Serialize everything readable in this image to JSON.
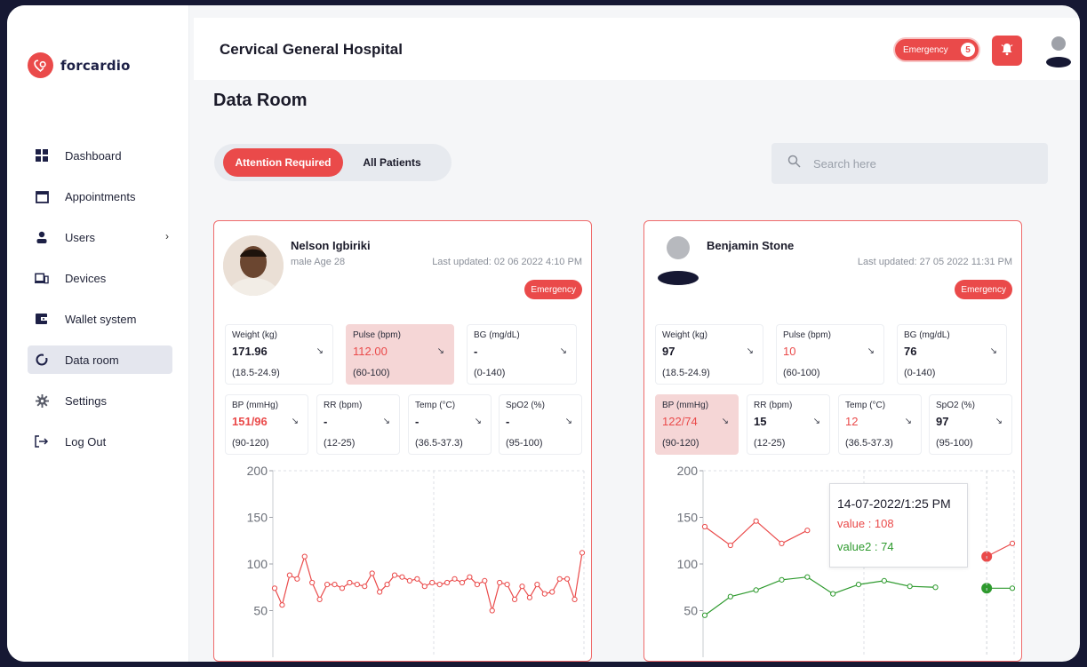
{
  "brand": {
    "name": "forcardio",
    "accent": "#ea4a4a"
  },
  "sidebar": {
    "items": [
      {
        "label": "Dashboard",
        "icon": "dashboard-grid-icon"
      },
      {
        "label": "Appointments",
        "icon": "calendar-icon"
      },
      {
        "label": "Users",
        "icon": "user-icon"
      },
      {
        "label": "Devices",
        "icon": "devices-icon"
      },
      {
        "label": "Wallet system",
        "icon": "wallet-icon"
      },
      {
        "label": "Data room",
        "icon": "data-room-icon",
        "active": true
      },
      {
        "label": "Settings",
        "icon": "gear-icon"
      },
      {
        "label": "Log Out",
        "icon": "logout-icon"
      }
    ]
  },
  "header": {
    "hospital": "Cervical General Hospital",
    "emergency_label": "Emergency",
    "emergency_count": "5"
  },
  "page": {
    "title": "Data Room"
  },
  "tabs": {
    "active": "Attention Required",
    "inactive": "All Patients"
  },
  "search": {
    "placeholder": "Search here"
  },
  "patients": [
    {
      "name": "Nelson Igbiriki",
      "sub": "male Age 28",
      "updated": "Last updated: 02 06 2022 4:10 PM",
      "badge": "Emergency",
      "vitals_row1": [
        {
          "label": "Weight (kg)",
          "value": "171.96",
          "range": "(18.5-24.9)"
        },
        {
          "label": "Pulse (bpm)",
          "value": "112.00",
          "range": "(60-100)",
          "alert": true
        },
        {
          "label": "BG (mg/dL)",
          "value": "-",
          "range": "(0-140)"
        }
      ],
      "vitals_row2": [
        {
          "label": "BP (mmHg)",
          "value": "151/96",
          "range": "(90-120)",
          "red": true
        },
        {
          "label": "RR (bpm)",
          "value": "-",
          "range": "(12-25)"
        },
        {
          "label": "Temp (°C)",
          "value": "-",
          "range": "(36.5-37.3)"
        },
        {
          "label": "SpO2 (%)",
          "value": "-",
          "range": "(95-100)"
        }
      ]
    },
    {
      "name": "Benjamin Stone",
      "updated": "Last updated: 27 05 2022 11:31 PM",
      "badge": "Emergency",
      "vitals_row1": [
        {
          "label": "Weight (kg)",
          "value": "97",
          "range": "(18.5-24.9)"
        },
        {
          "label": "Pulse (bpm)",
          "value": "10",
          "range": "(60-100)",
          "red": true
        },
        {
          "label": "BG (mg/dL)",
          "value": "76",
          "range": "(0-140)"
        }
      ],
      "vitals_row2": [
        {
          "label": "BP (mmHg)",
          "value": "122/74",
          "range": "(90-120)",
          "alert": true
        },
        {
          "label": "RR (bpm)",
          "value": "15",
          "range": "(12-25)"
        },
        {
          "label": "Temp (°C)",
          "value": "12",
          "range": "(36.5-37.3)",
          "red": true
        },
        {
          "label": "SpO2 (%)",
          "value": "97",
          "range": "(95-100)"
        }
      ],
      "tooltip": {
        "date": "14-07-2022/1:25 PM",
        "value1": "value : 108",
        "value2": "value2 : 74"
      }
    }
  ],
  "chart_data": [
    {
      "type": "line",
      "ylim": [
        0,
        200
      ],
      "yticks": [
        200,
        150,
        100,
        50
      ],
      "series": [
        {
          "color": "#ea4a4a",
          "values": [
            74,
            56,
            88,
            84,
            108,
            80,
            62,
            78,
            78,
            74,
            80,
            78,
            76,
            90,
            70,
            78,
            88,
            86,
            82,
            84,
            76,
            80,
            78,
            80,
            84,
            80,
            86,
            78,
            82,
            50,
            80,
            78,
            62,
            76,
            64,
            78,
            68,
            70,
            84,
            84,
            62,
            112
          ]
        }
      ]
    },
    {
      "type": "line",
      "ylim": [
        0,
        200
      ],
      "yticks": [
        200,
        150,
        100,
        50
      ],
      "series": [
        {
          "color": "#ea4a4a",
          "values": [
            140,
            120,
            146,
            122,
            136,
            null,
            null,
            null,
            null,
            null,
            null,
            108,
            122
          ]
        },
        {
          "color": "#2e9a2e",
          "values": [
            45,
            65,
            72,
            83,
            86,
            68,
            78,
            82,
            76,
            75,
            null,
            74,
            74
          ]
        }
      ],
      "highlight_index": 11
    }
  ]
}
